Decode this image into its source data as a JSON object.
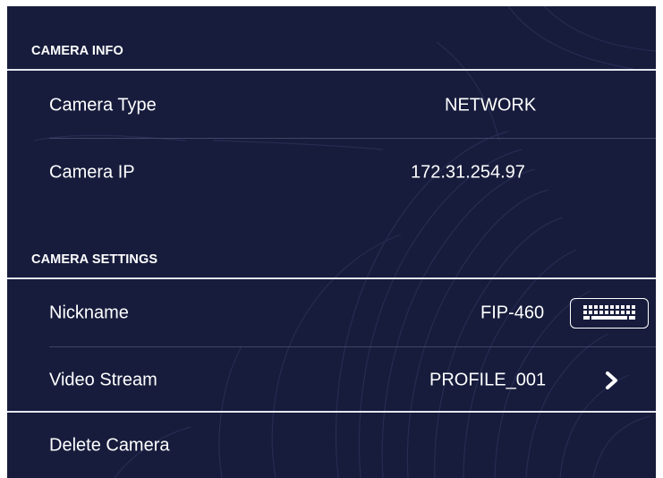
{
  "camera_info": {
    "title": "CAMERA INFO",
    "camera_type": {
      "label": "Camera Type",
      "value": "NETWORK"
    },
    "camera_ip": {
      "label": "Camera IP",
      "value": "172.31.254.97"
    }
  },
  "camera_settings": {
    "title": "CAMERA SETTINGS",
    "nickname": {
      "label": "Nickname",
      "value": "FIP-460",
      "icon": "keyboard-icon"
    },
    "video_stream": {
      "label": "Video Stream",
      "value": "PROFILE_001",
      "icon": "chevron-right-icon"
    },
    "delete": {
      "label": "Delete Camera"
    }
  },
  "colors": {
    "background": "#171c3c",
    "text": "#ffffff",
    "divider": "#40456a",
    "section_line": "#e4e6ee"
  }
}
